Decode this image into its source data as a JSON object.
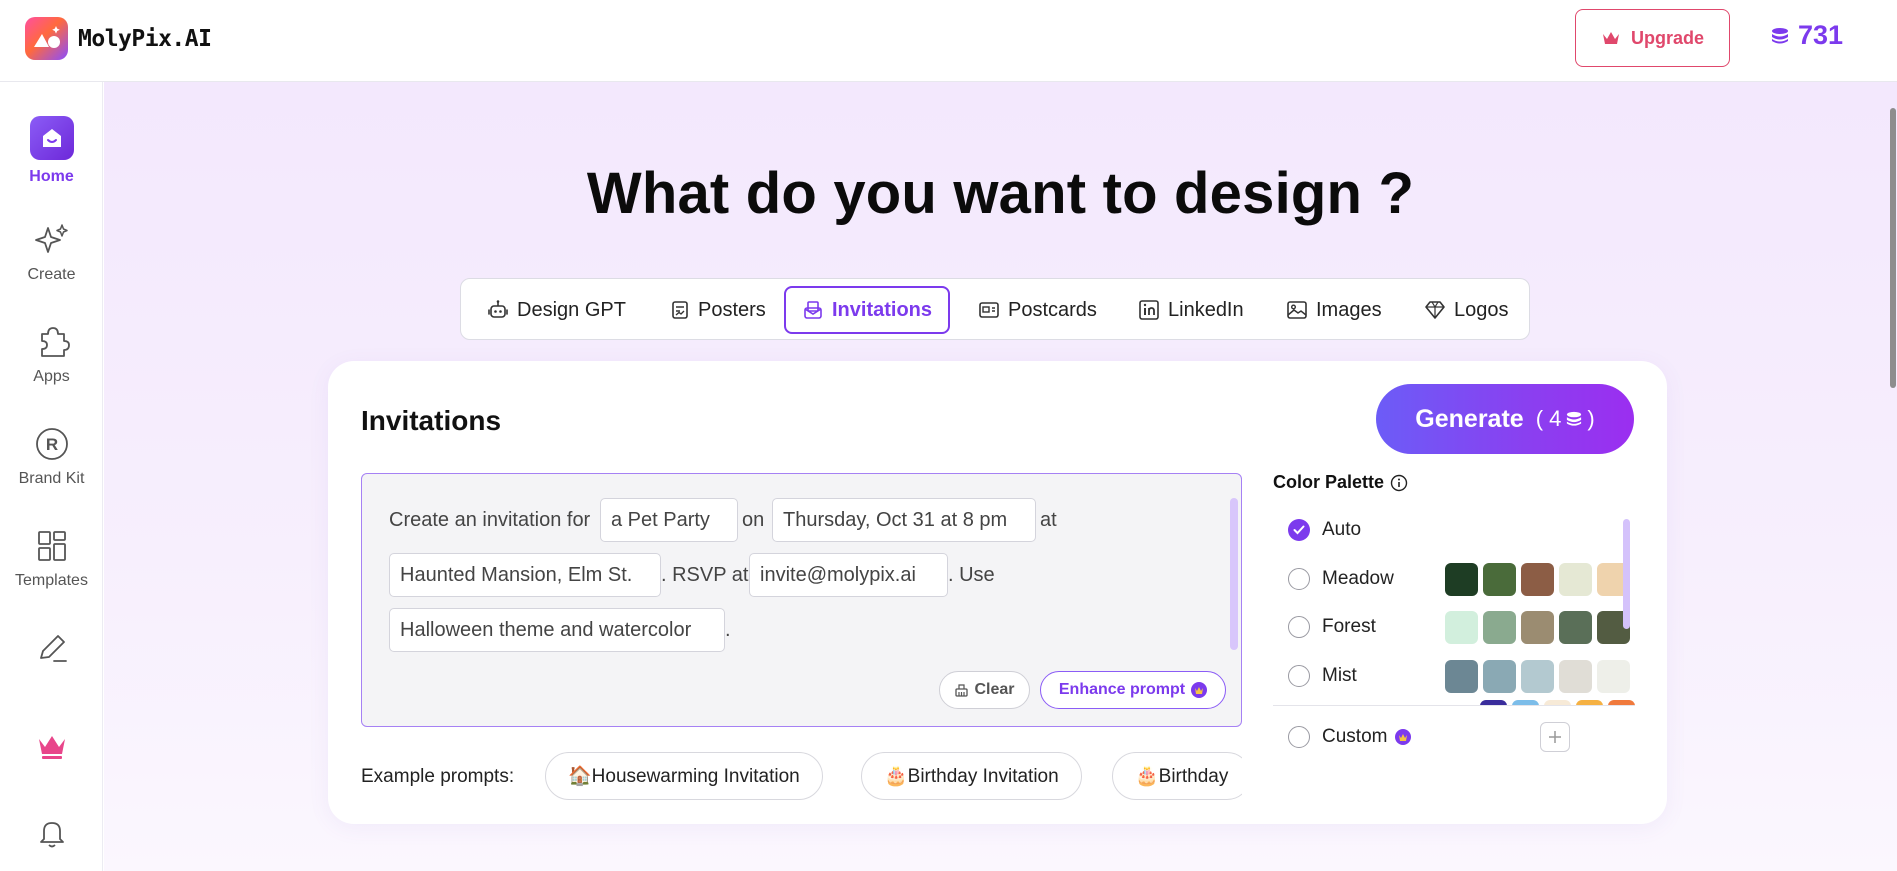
{
  "app": {
    "name": "MolyPix.AI"
  },
  "header": {
    "upgrade_label": "Upgrade",
    "credits": "731"
  },
  "sidebar": {
    "items": [
      {
        "label": "Home",
        "icon": "home-icon",
        "active": true
      },
      {
        "label": "Create",
        "icon": "sparkle-icon"
      },
      {
        "label": "Apps",
        "icon": "puzzle-icon"
      },
      {
        "label": "Brand Kit",
        "icon": "registered-icon"
      },
      {
        "label": "Templates",
        "icon": "grid-icon"
      }
    ],
    "extra_icons": [
      "edit-icon",
      "crown-icon",
      "bell-icon"
    ]
  },
  "main": {
    "headline": "What do you want to design ?",
    "tabs": [
      {
        "label": "Design GPT",
        "icon": "robot-icon"
      },
      {
        "label": "Posters",
        "icon": "poster-icon"
      },
      {
        "label": "Invitations",
        "icon": "invitation-icon",
        "active": true
      },
      {
        "label": "Postcards",
        "icon": "postcard-icon"
      },
      {
        "label": "LinkedIn",
        "icon": "linkedin-icon"
      },
      {
        "label": "Images",
        "icon": "image-icon"
      },
      {
        "label": "Logos",
        "icon": "diamond-icon"
      }
    ]
  },
  "card": {
    "title": "Invitations",
    "generate_label": "Generate",
    "generate_cost": "( 4",
    "generate_cost_close": ")",
    "prompt": {
      "t1": "Create an invitation for",
      "v_event": "a Pet Party",
      "t2": "on",
      "v_date": "Thursday, Oct 31 at 8 pm",
      "t3": "at",
      "v_place": "Haunted Mansion, Elm St.",
      "t4": ". RSVP at",
      "v_rsvp": "invite@molypix.ai",
      "t5": ". Use",
      "v_theme": "Halloween theme and watercolor",
      "t6": "."
    },
    "clear_label": "Clear",
    "enhance_label": "Enhance prompt",
    "examples_label": "Example prompts:",
    "examples": [
      "🏠Housewarming Invitation",
      "🎂Birthday Invitation",
      "🎂Birthday"
    ]
  },
  "palette": {
    "title": "Color Palette",
    "options": [
      {
        "name": "Auto",
        "checked": true,
        "colors": []
      },
      {
        "name": "Meadow",
        "colors": [
          "#1e3d24",
          "#4a6b3a",
          "#8c5d45",
          "#e5e8d4",
          "#efd3ad"
        ]
      },
      {
        "name": "Forest",
        "colors": [
          "#d2efdd",
          "#8aaa8f",
          "#9b8c71",
          "#5a6f58",
          "#535c42"
        ]
      },
      {
        "name": "Mist",
        "colors": [
          "#6c8794",
          "#8aa9b4",
          "#b3c9d0",
          "#e0ddd6",
          "#eeefe9"
        ]
      }
    ],
    "peek_colors": [
      "#3a2d9c",
      "#7cbde9",
      "#f7ead7",
      "#f5b143",
      "#f07a3d"
    ],
    "custom_label": "Custom"
  }
}
